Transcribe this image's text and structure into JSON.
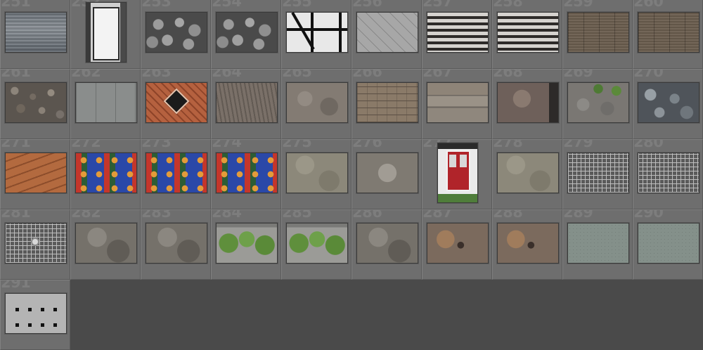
{
  "app": {
    "view": "grid"
  },
  "thumbnails": [
    {
      "number": "251",
      "label": "251",
      "orientation": "land",
      "texture": "t-wood-grey"
    },
    {
      "number": "252",
      "label": "252",
      "orientation": "port",
      "texture": "t-door-white"
    },
    {
      "number": "253",
      "label": "253",
      "orientation": "land",
      "texture": "t-cobble"
    },
    {
      "number": "254",
      "label": "254",
      "orientation": "land",
      "texture": "t-cobble"
    },
    {
      "number": "255",
      "label": "255",
      "orientation": "land",
      "texture": "t-timber"
    },
    {
      "number": "256",
      "label": "256",
      "orientation": "land",
      "texture": "t-chevron"
    },
    {
      "number": "257",
      "label": "257",
      "orientation": "land",
      "texture": "t-slats"
    },
    {
      "number": "258",
      "label": "258",
      "orientation": "land",
      "texture": "t-slats"
    },
    {
      "number": "259",
      "label": "259",
      "orientation": "land",
      "texture": "t-planks-brown"
    },
    {
      "number": "260",
      "label": "260",
      "orientation": "land",
      "texture": "t-planks-brown"
    },
    {
      "number": "261",
      "label": "261",
      "orientation": "land",
      "texture": "t-stone-wall"
    },
    {
      "number": "262",
      "label": "262",
      "orientation": "land",
      "texture": "t-grey-boards"
    },
    {
      "number": "263",
      "label": "263",
      "orientation": "land",
      "texture": "t-red-door"
    },
    {
      "number": "264",
      "label": "264",
      "orientation": "land",
      "texture": "t-bark"
    },
    {
      "number": "265",
      "label": "265",
      "orientation": "land",
      "texture": "t-rough-grey"
    },
    {
      "number": "266",
      "label": "266",
      "orientation": "land",
      "texture": "t-brick-stone"
    },
    {
      "number": "267",
      "label": "267",
      "orientation": "land",
      "texture": "t-layered"
    },
    {
      "number": "268",
      "label": "268",
      "orientation": "land",
      "texture": "t-rust-wall"
    },
    {
      "number": "269",
      "label": "269",
      "orientation": "land",
      "texture": "t-mossy"
    },
    {
      "number": "270",
      "label": "270",
      "orientation": "land",
      "texture": "t-blocks-blue"
    },
    {
      "number": "271",
      "label": "271",
      "orientation": "land",
      "texture": "t-orange-wood"
    },
    {
      "number": "272",
      "label": "272",
      "orientation": "land",
      "texture": "t-dots"
    },
    {
      "number": "273",
      "label": "273",
      "orientation": "land",
      "texture": "t-dots"
    },
    {
      "number": "274",
      "label": "274",
      "orientation": "land",
      "texture": "t-dots"
    },
    {
      "number": "275",
      "label": "275",
      "orientation": "land",
      "texture": "t-plaster"
    },
    {
      "number": "276",
      "label": "276",
      "orientation": "land",
      "texture": "t-cracked"
    },
    {
      "number": "277",
      "label": "277",
      "orientation": "port",
      "texture": "t-doorframe"
    },
    {
      "number": "278",
      "label": "278",
      "orientation": "land",
      "texture": "t-plaster"
    },
    {
      "number": "279",
      "label": "279",
      "orientation": "land",
      "texture": "t-wire"
    },
    {
      "number": "280",
      "label": "280",
      "orientation": "land",
      "texture": "t-wire"
    },
    {
      "number": "281",
      "label": "281",
      "orientation": "land",
      "texture": "t-wire"
    },
    {
      "number": "282",
      "label": "282",
      "orientation": "land",
      "texture": "t-rock"
    },
    {
      "number": "283",
      "label": "283",
      "orientation": "land",
      "texture": "t-rock"
    },
    {
      "number": "284",
      "label": "284",
      "orientation": "land",
      "texture": "t-ivy"
    },
    {
      "number": "285",
      "label": "285",
      "orientation": "land",
      "texture": "t-ivy"
    },
    {
      "number": "286",
      "label": "286",
      "orientation": "land",
      "texture": "t-rock"
    },
    {
      "number": "287",
      "label": "287",
      "orientation": "land",
      "texture": "t-rusty-rock"
    },
    {
      "number": "288",
      "label": "288",
      "orientation": "land",
      "texture": "t-rusty-rock"
    },
    {
      "number": "289",
      "label": "289",
      "orientation": "land",
      "texture": "t-green-plaster"
    },
    {
      "number": "290",
      "label": "290",
      "orientation": "land",
      "texture": "t-green-plaster"
    },
    {
      "number": "291",
      "label": "291",
      "orientation": "land",
      "texture": "t-holes"
    }
  ],
  "colors": {
    "background": "#4a4a4a",
    "cell": "#6e6e6e",
    "number": "#7d7d7d"
  }
}
